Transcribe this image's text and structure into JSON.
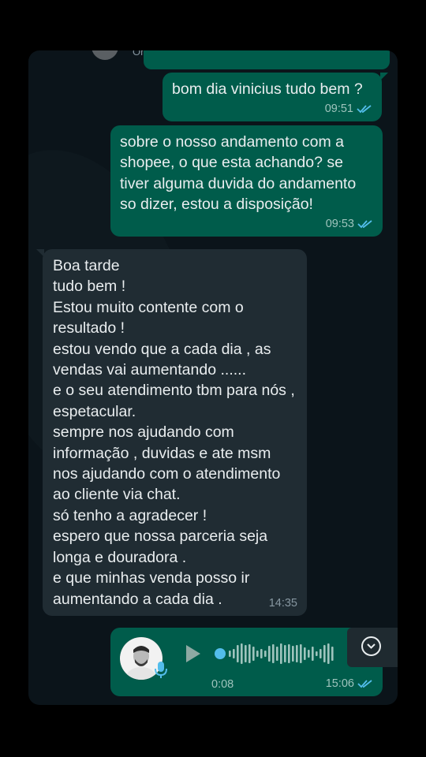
{
  "header": {
    "status": "Online"
  },
  "messages": [
    {
      "text": "bom dia vinicius tudo bem ?",
      "time": "09:51"
    },
    {
      "text": "sobre o nosso andamento com a shopee,  o que esta achando? se tiver alguma duvida do andamento so dizer, estou a disposição!",
      "time": "09:53"
    },
    {
      "text": "Boa tarde\ntudo bem !\nEstou muito contente com o resultado !\nestou vendo que a cada dia , as vendas vai aumentando ......\ne o seu atendimento tbm para nós , espetacular.\nsempre nos ajudando com informação , duvidas e ate msm nos ajudando com o atendimento ao cliente via chat.\nsó tenho a agradecer !\nespero que nossa parceria seja longa e douradora .\ne que minhas venda posso ir aumentando a cada dia .",
      "time": "14:35"
    }
  ],
  "audio": {
    "duration": "0:08",
    "time": "15:06"
  },
  "colors": {
    "outgoing": "#005c4b",
    "incoming": "#202c33",
    "read_ticks": "#53bdeb",
    "background": "#0b141a"
  },
  "icons": [
    "double-check-icon",
    "play-icon",
    "microphone-icon",
    "scroll-down-icon"
  ]
}
